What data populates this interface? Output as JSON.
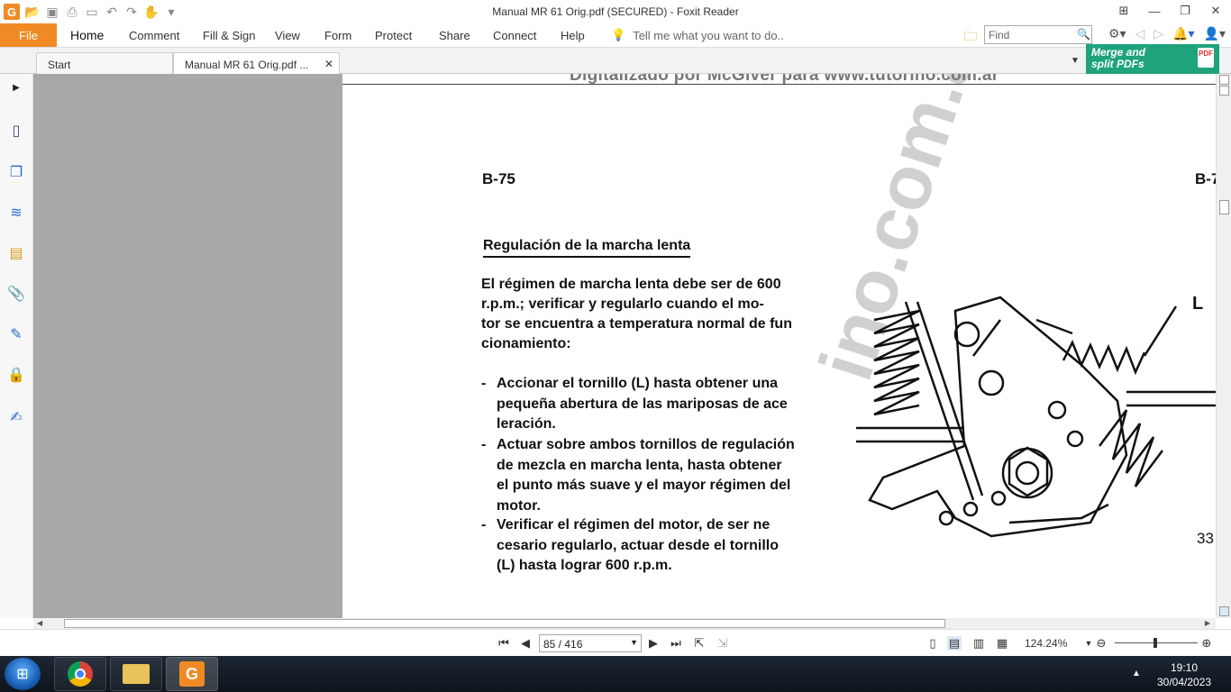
{
  "window": {
    "title": "Manual MR 61 Orig.pdf (SECURED) - Foxit Reader"
  },
  "menu": {
    "file": "File",
    "items": [
      "Home",
      "Comment",
      "Fill & Sign",
      "View",
      "Form",
      "Protect",
      "Share",
      "Connect",
      "Help"
    ],
    "tellme": "Tell me what you want to do..",
    "find_placeholder": "Find"
  },
  "tabs": {
    "start": "Start",
    "doc": "Manual MR 61 Orig.pdf ..."
  },
  "promo": {
    "line1": "Merge and",
    "line2": "split PDFs"
  },
  "document": {
    "top_watermark": "Digitalizado por McGiver para www.tutorino.com.ar",
    "page_label_left": "B-75",
    "page_label_right": "B-7",
    "heading": "Regulación de la marcha lenta",
    "intro_lines": [
      "El régimen de marcha lenta debe ser de 600",
      "r.p.m.; verificar y regularlo cuando el mo-",
      "tor se encuentra a temperatura normal de fun",
      "cionamiento:"
    ],
    "bullets": [
      [
        "Accionar el tornillo (L) hasta obtener una",
        "pequeña abertura de las mariposas de ace",
        "leración."
      ],
      [
        "Actuar sobre ambos tornillos de regulación",
        "de mezcla en marcha lenta, hasta obtener",
        "el punto más suave y el mayor régimen del",
        "motor."
      ],
      [
        "Verificar el régimen del motor, de ser ne",
        "cesario regularlo, actuar desde el tornillo",
        "(L) hasta lograr 600 r.p.m."
      ]
    ],
    "figure_label": "L",
    "figure_number": "33",
    "diagonal_watermark": "ino.com.ar"
  },
  "status": {
    "page": "85 / 416",
    "zoom": "124.24%"
  },
  "taskbar": {
    "time": "19:10",
    "date": "30/04/2023"
  },
  "colors": {
    "accent": "#f08a24",
    "promo": "#1fa37c"
  }
}
